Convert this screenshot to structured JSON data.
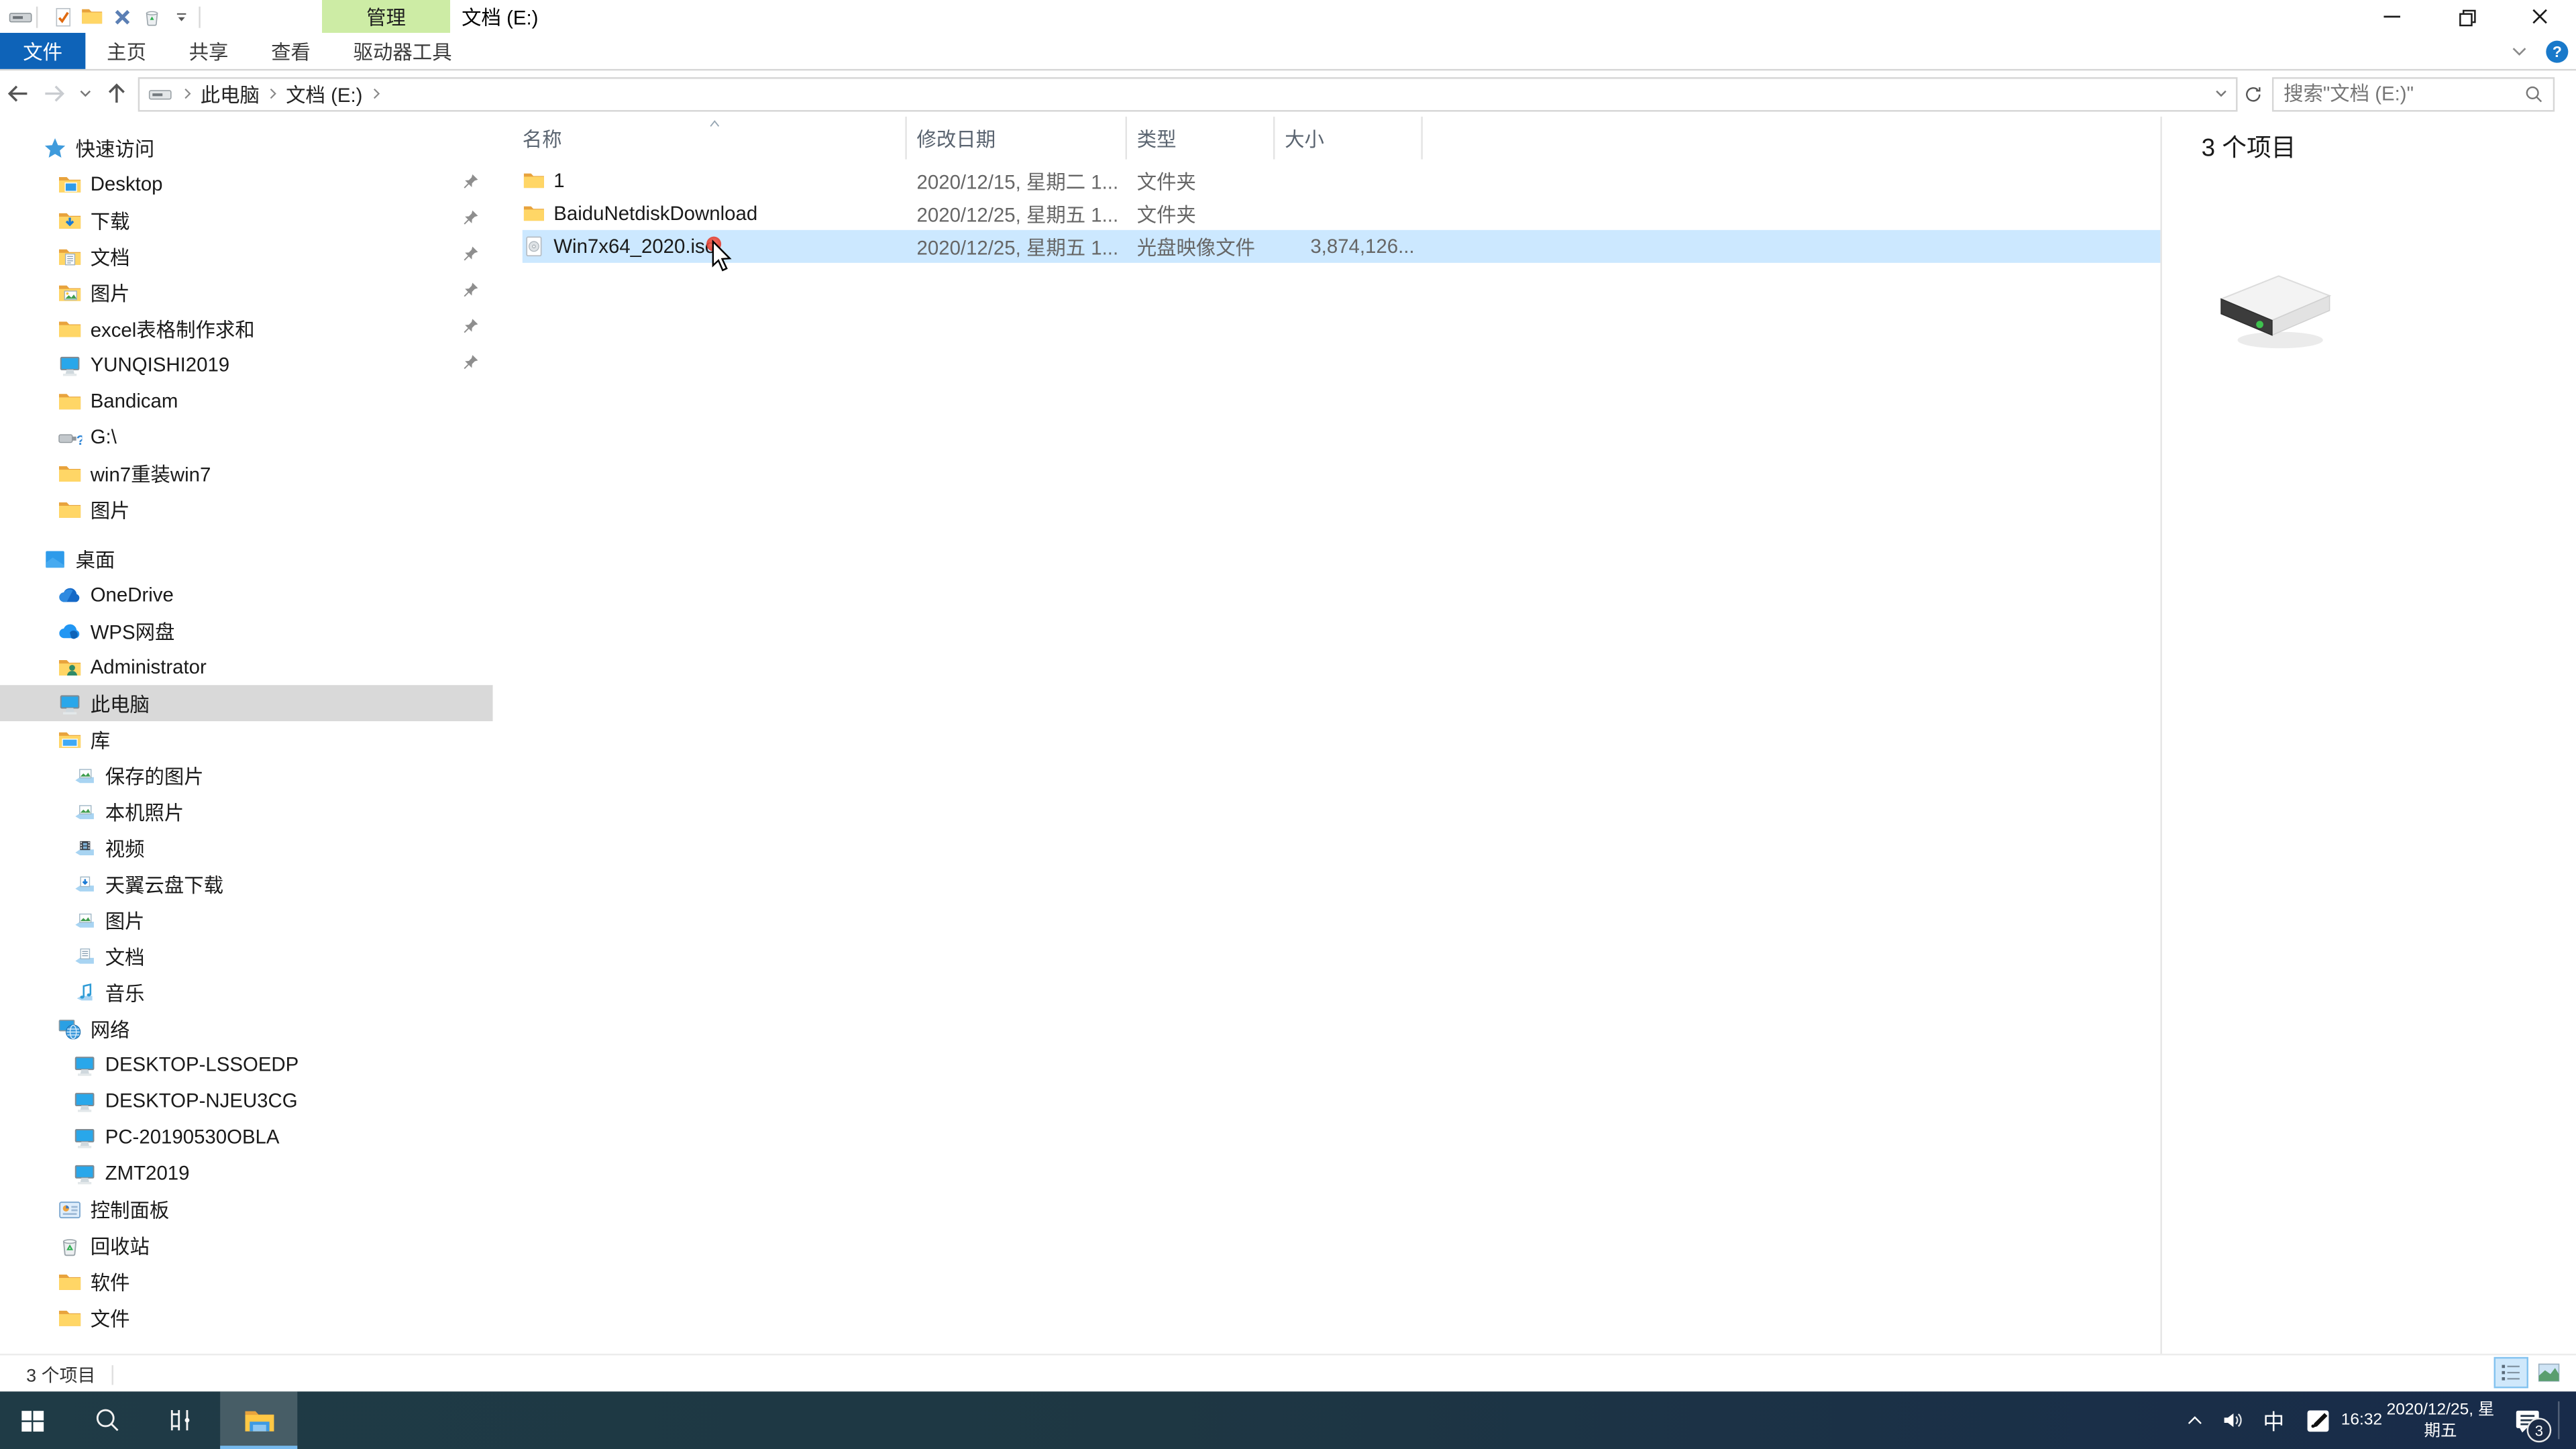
{
  "window": {
    "title": "文档 (E:)",
    "contextual_tab_header": "管理"
  },
  "qat": {
    "icons": [
      "window-drive-icon",
      "undo-check-icon",
      "new-folder-icon",
      "delete-x-icon",
      "recycle-icon",
      "qat-dropdown-icon"
    ]
  },
  "ribbon": {
    "file_tab": "文件",
    "tabs": [
      "主页",
      "共享",
      "查看",
      "驱动器工具"
    ]
  },
  "navigation": {
    "breadcrumb": [
      "此电脑",
      "文档 (E:)"
    ],
    "search_placeholder": "搜索\"文档 (E:)\""
  },
  "sidebar": {
    "items": [
      {
        "label": "快速访问",
        "icon": "star",
        "indent": 0,
        "pinned": false,
        "selected": false,
        "gap": false
      },
      {
        "label": "Desktop",
        "icon": "folder-desktop",
        "indent": 1,
        "pinned": true,
        "selected": false,
        "gap": false
      },
      {
        "label": "下载",
        "icon": "folder-download",
        "indent": 1,
        "pinned": true,
        "selected": false,
        "gap": false
      },
      {
        "label": "文档",
        "icon": "folder-doc",
        "indent": 1,
        "pinned": true,
        "selected": false,
        "gap": false
      },
      {
        "label": "图片",
        "icon": "folder-img",
        "indent": 1,
        "pinned": true,
        "selected": false,
        "gap": false
      },
      {
        "label": "excel表格制作求和",
        "icon": "folder",
        "indent": 1,
        "pinned": true,
        "selected": false,
        "gap": false
      },
      {
        "label": "YUNQISHI2019",
        "icon": "monitor",
        "indent": 1,
        "pinned": true,
        "selected": false,
        "gap": false
      },
      {
        "label": "Bandicam",
        "icon": "folder",
        "indent": 1,
        "pinned": false,
        "selected": false,
        "gap": false
      },
      {
        "label": "G:\\",
        "icon": "usb",
        "indent": 1,
        "pinned": false,
        "selected": false,
        "gap": false
      },
      {
        "label": "win7重装win7",
        "icon": "folder",
        "indent": 1,
        "pinned": false,
        "selected": false,
        "gap": false
      },
      {
        "label": "图片",
        "icon": "folder",
        "indent": 1,
        "pinned": false,
        "selected": false,
        "gap": false
      },
      {
        "label": "桌面",
        "icon": "desktop",
        "indent": 0,
        "pinned": false,
        "selected": false,
        "gap": true
      },
      {
        "label": "OneDrive",
        "icon": "cloud",
        "indent": 1,
        "pinned": false,
        "selected": false,
        "gap": false
      },
      {
        "label": "WPS网盘",
        "icon": "cloud-blue",
        "indent": 1,
        "pinned": false,
        "selected": false,
        "gap": false
      },
      {
        "label": "Administrator",
        "icon": "folder-user",
        "indent": 1,
        "pinned": false,
        "selected": false,
        "gap": false
      },
      {
        "label": "此电脑",
        "icon": "monitor",
        "indent": 1,
        "pinned": false,
        "selected": true,
        "gap": false
      },
      {
        "label": "库",
        "icon": "library",
        "indent": 1,
        "pinned": false,
        "selected": false,
        "gap": false
      },
      {
        "label": "保存的图片",
        "icon": "lib-img",
        "indent": 2,
        "pinned": false,
        "selected": false,
        "gap": false
      },
      {
        "label": "本机照片",
        "icon": "lib-img",
        "indent": 2,
        "pinned": false,
        "selected": false,
        "gap": false
      },
      {
        "label": "视频",
        "icon": "lib-film",
        "indent": 2,
        "pinned": false,
        "selected": false,
        "gap": false
      },
      {
        "label": "天翼云盘下载",
        "icon": "lib-cloud",
        "indent": 2,
        "pinned": false,
        "selected": false,
        "gap": false
      },
      {
        "label": "图片",
        "icon": "lib-img",
        "indent": 2,
        "pinned": false,
        "selected": false,
        "gap": false
      },
      {
        "label": "文档",
        "icon": "lib-doc",
        "indent": 2,
        "pinned": false,
        "selected": false,
        "gap": false
      },
      {
        "label": "音乐",
        "icon": "lib-music",
        "indent": 2,
        "pinned": false,
        "selected": false,
        "gap": false
      },
      {
        "label": "网络",
        "icon": "globe",
        "indent": 1,
        "pinned": false,
        "selected": false,
        "gap": false
      },
      {
        "label": "DESKTOP-LSSOEDP",
        "icon": "netpc",
        "indent": 2,
        "pinned": false,
        "selected": false,
        "gap": false
      },
      {
        "label": "DESKTOP-NJEU3CG",
        "icon": "netpc",
        "indent": 2,
        "pinned": false,
        "selected": false,
        "gap": false
      },
      {
        "label": "PC-20190530OBLA",
        "icon": "netpc",
        "indent": 2,
        "pinned": false,
        "selected": false,
        "gap": false
      },
      {
        "label": "ZMT2019",
        "icon": "netpc",
        "indent": 2,
        "pinned": false,
        "selected": false,
        "gap": false
      },
      {
        "label": "控制面板",
        "icon": "control-panel",
        "indent": 1,
        "pinned": false,
        "selected": false,
        "gap": false
      },
      {
        "label": "回收站",
        "icon": "recycle",
        "indent": 1,
        "pinned": false,
        "selected": false,
        "gap": false
      },
      {
        "label": "软件",
        "icon": "folder",
        "indent": 1,
        "pinned": false,
        "selected": false,
        "gap": false
      },
      {
        "label": "文件",
        "icon": "folder",
        "indent": 1,
        "pinned": false,
        "selected": false,
        "gap": false
      }
    ]
  },
  "file_list": {
    "columns": [
      {
        "label": "名称",
        "sorted": true
      },
      {
        "label": "修改日期",
        "sorted": false
      },
      {
        "label": "类型",
        "sorted": false
      },
      {
        "label": "大小",
        "sorted": false
      }
    ],
    "rows": [
      {
        "icon": "folder",
        "name": "1",
        "date": "2020/12/15, 星期二 1...",
        "type": "文件夹",
        "size": "",
        "selected": false
      },
      {
        "icon": "folder",
        "name": "BaiduNetdiskDownload",
        "date": "2020/12/25, 星期五 1...",
        "type": "文件夹",
        "size": "",
        "selected": false
      },
      {
        "icon": "iso",
        "name": "Win7x64_2020.iso",
        "date": "2020/12/25, 星期五 1...",
        "type": "光盘映像文件",
        "size": "3,874,126...",
        "selected": true
      }
    ]
  },
  "right_panel": {
    "item_count_label": "3 个项目"
  },
  "status_bar": {
    "item_count": "3 个项目"
  },
  "taskbar": {
    "tray": {
      "ime": "中",
      "time": "16:32",
      "date": "2020/12/25, 星期五",
      "notification_badge": "3"
    }
  },
  "colors": {
    "accent_blue": "#0e63b8",
    "selection_blue": "#cce8ff",
    "contextual_green": "#cdeca5",
    "sidebar_selection": "#d9d9d9",
    "taskbar_left": "#1f3b46",
    "taskbar_right": "#182b4a"
  }
}
